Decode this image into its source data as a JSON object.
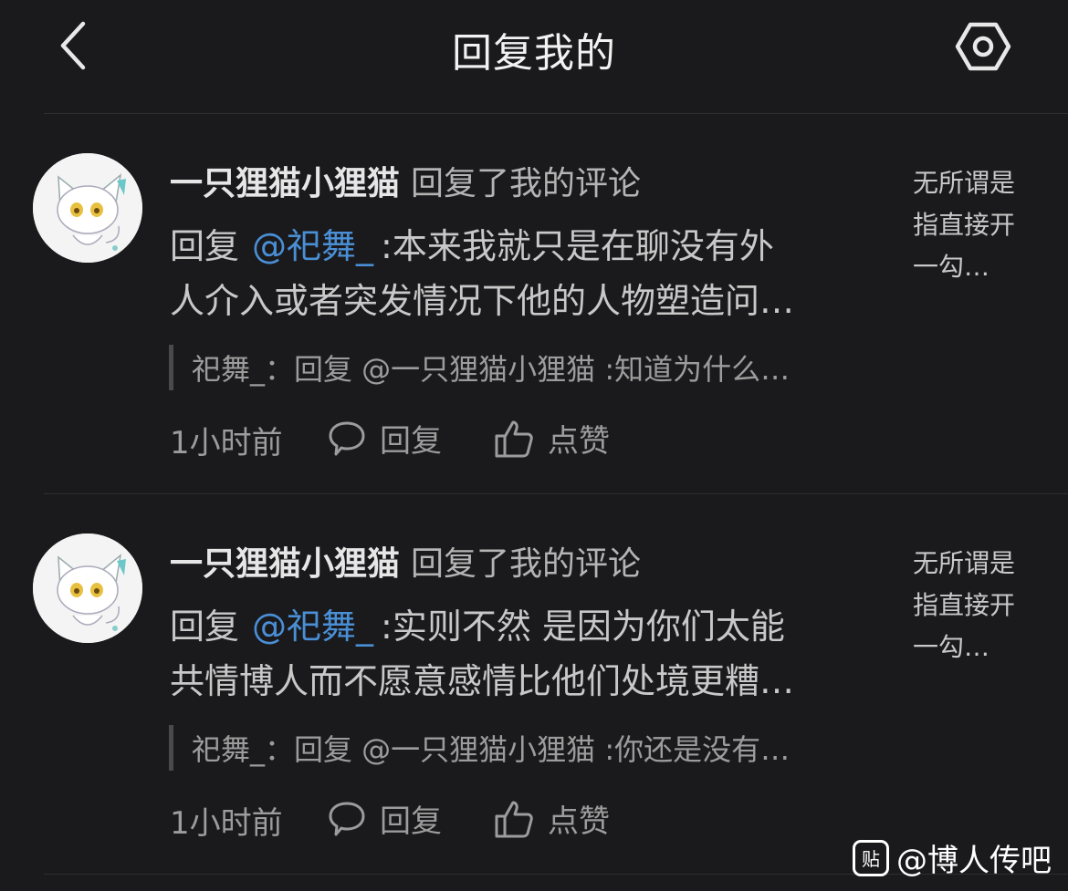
{
  "header": {
    "title": "回复我的",
    "back_icon": "chevron-left-icon",
    "settings_icon": "gear-icon"
  },
  "items": [
    {
      "username": "一只狸猫小狸猫",
      "action": "回复了我的评论",
      "reply_prefix": "回复",
      "mention": "@祀舞_",
      "reply_line1": ":本来我就只是在聊没有外",
      "reply_line2": "人介入或者突发情况下他的人物塑造问…",
      "quote": "祀舞_：回复 @一只狸猫小狸猫 :知道为什么…",
      "time": "1小时前",
      "reply_label": "回复",
      "like_label": "点赞",
      "original_comment": "无所谓是指直接开一勾…"
    },
    {
      "username": "一只狸猫小狸猫",
      "action": "回复了我的评论",
      "reply_prefix": "回复",
      "mention": "@祀舞_",
      "reply_line1": ":实则不然 是因为你们太能",
      "reply_line2": "共情博人而不愿意感情比他们处境更糟…",
      "quote": "祀舞_：回复 @一只狸猫小狸猫 :你还是没有…",
      "time": "1小时前",
      "reply_label": "回复",
      "like_label": "点赞",
      "original_comment": "无所谓是指直接开一勾…"
    }
  ],
  "watermark": {
    "logo_text": "贴",
    "text": "@博人传吧"
  },
  "colors": {
    "background": "#1a1a1c",
    "mention": "#4a8fd6",
    "divider": "#2e2e31"
  }
}
